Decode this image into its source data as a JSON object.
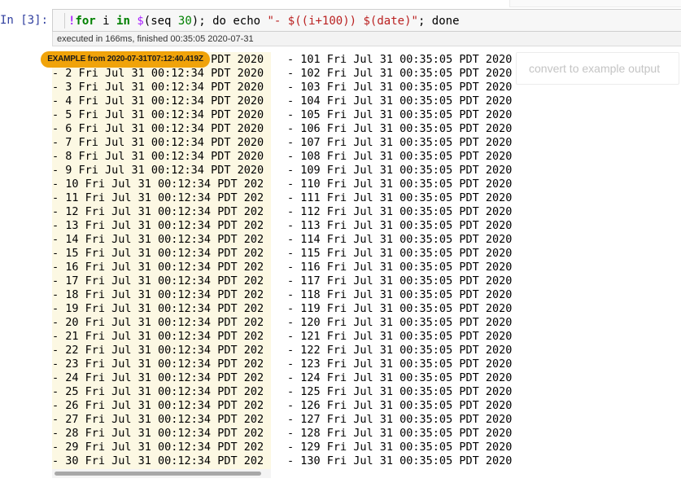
{
  "cell": {
    "prompt": "In [3]:",
    "code": {
      "bang": "!",
      "kw_for": "for",
      "t1": " i ",
      "kw_in": "in",
      "t2": " ",
      "dollar": "$",
      "t3": "(seq ",
      "num": "30",
      "t4": "); do echo ",
      "str": "\"- $((i+100)) $(date)\"",
      "t5": "; done"
    },
    "execution_info": "executed in 166ms, finished 00:35:05 2020-07-31"
  },
  "example_badge": "EXAMPLE from 2020-07-31T07:12:40.419Z",
  "convert_button": "convert to example output",
  "output": {
    "example_lines": [
      "- 1 Fri Jul 31 00:12:34 PDT 2020",
      "- 2 Fri Jul 31 00:12:34 PDT 2020",
      "- 3 Fri Jul 31 00:12:34 PDT 2020",
      "- 4 Fri Jul 31 00:12:34 PDT 2020",
      "- 5 Fri Jul 31 00:12:34 PDT 2020",
      "- 6 Fri Jul 31 00:12:34 PDT 2020",
      "- 7 Fri Jul 31 00:12:34 PDT 2020",
      "- 8 Fri Jul 31 00:12:34 PDT 2020",
      "- 9 Fri Jul 31 00:12:34 PDT 2020",
      "- 10 Fri Jul 31 00:12:34 PDT 202",
      "- 11 Fri Jul 31 00:12:34 PDT 202",
      "- 12 Fri Jul 31 00:12:34 PDT 202",
      "- 13 Fri Jul 31 00:12:34 PDT 202",
      "- 14 Fri Jul 31 00:12:34 PDT 202",
      "- 15 Fri Jul 31 00:12:34 PDT 202",
      "- 16 Fri Jul 31 00:12:34 PDT 202",
      "- 17 Fri Jul 31 00:12:34 PDT 202",
      "- 18 Fri Jul 31 00:12:34 PDT 202",
      "- 19 Fri Jul 31 00:12:34 PDT 202",
      "- 20 Fri Jul 31 00:12:34 PDT 202",
      "- 21 Fri Jul 31 00:12:34 PDT 202",
      "- 22 Fri Jul 31 00:12:34 PDT 202",
      "- 23 Fri Jul 31 00:12:34 PDT 202",
      "- 24 Fri Jul 31 00:12:34 PDT 202",
      "- 25 Fri Jul 31 00:12:34 PDT 202",
      "- 26 Fri Jul 31 00:12:34 PDT 202",
      "- 27 Fri Jul 31 00:12:34 PDT 202",
      "- 28 Fri Jul 31 00:12:34 PDT 202",
      "- 29 Fri Jul 31 00:12:34 PDT 202",
      "- 30 Fri Jul 31 00:12:34 PDT 202"
    ],
    "current_lines": [
      "- 101 Fri Jul 31 00:35:05 PDT 2020",
      "- 102 Fri Jul 31 00:35:05 PDT 2020",
      "- 103 Fri Jul 31 00:35:05 PDT 2020",
      "- 104 Fri Jul 31 00:35:05 PDT 2020",
      "- 105 Fri Jul 31 00:35:05 PDT 2020",
      "- 106 Fri Jul 31 00:35:05 PDT 2020",
      "- 107 Fri Jul 31 00:35:05 PDT 2020",
      "- 108 Fri Jul 31 00:35:05 PDT 2020",
      "- 109 Fri Jul 31 00:35:05 PDT 2020",
      "- 110 Fri Jul 31 00:35:05 PDT 2020",
      "- 111 Fri Jul 31 00:35:05 PDT 2020",
      "- 112 Fri Jul 31 00:35:05 PDT 2020",
      "- 113 Fri Jul 31 00:35:05 PDT 2020",
      "- 114 Fri Jul 31 00:35:05 PDT 2020",
      "- 115 Fri Jul 31 00:35:05 PDT 2020",
      "- 116 Fri Jul 31 00:35:05 PDT 2020",
      "- 117 Fri Jul 31 00:35:05 PDT 2020",
      "- 118 Fri Jul 31 00:35:05 PDT 2020",
      "- 119 Fri Jul 31 00:35:05 PDT 2020",
      "- 120 Fri Jul 31 00:35:05 PDT 2020",
      "- 121 Fri Jul 31 00:35:05 PDT 2020",
      "- 122 Fri Jul 31 00:35:05 PDT 2020",
      "- 123 Fri Jul 31 00:35:05 PDT 2020",
      "- 124 Fri Jul 31 00:35:05 PDT 2020",
      "- 125 Fri Jul 31 00:35:05 PDT 2020",
      "- 126 Fri Jul 31 00:35:05 PDT 2020",
      "- 127 Fri Jul 31 00:35:05 PDT 2020",
      "- 128 Fri Jul 31 00:35:05 PDT 2020",
      "- 129 Fri Jul 31 00:35:05 PDT 2020",
      "- 130 Fri Jul 31 00:35:05 PDT 2020"
    ]
  },
  "colors": {
    "example_background": "#fcf8e3",
    "badge": "#f0a30a",
    "prompt": "#303f9f",
    "keyword": "#008000",
    "string": "#ba2121",
    "magic": "#aa22ff"
  }
}
